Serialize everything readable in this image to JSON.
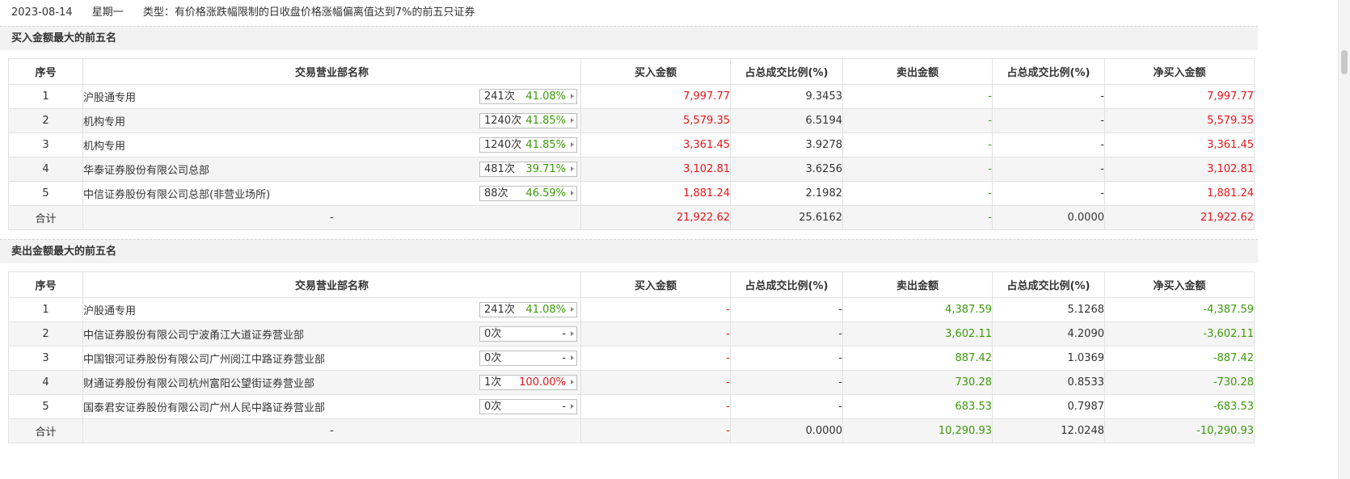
{
  "info": {
    "date": "2023-08-14",
    "weekday": "星期一",
    "type_text": "类型：有价格涨跌幅限制的日收盘价格涨幅偏离值达到7%的前五只证券"
  },
  "columns": [
    "序号",
    "交易营业部名称",
    "买入金额",
    "占总成交比例(%)",
    "卖出金额",
    "占总成交比例(%)",
    "净买入金额"
  ],
  "buy_section": {
    "title": "买入金额最大的前五名",
    "rows": [
      {
        "idx": "1",
        "name": "沪股通专用",
        "count": "241次",
        "pct": "41.08%",
        "pct_color": "green",
        "buy": "7,997.77",
        "buy_ratio": "9.3453",
        "sell": "-",
        "sell_ratio": "-",
        "net": "7,997.77"
      },
      {
        "idx": "2",
        "name": "机构专用",
        "count": "1240次",
        "pct": "41.85%",
        "pct_color": "green",
        "buy": "5,579.35",
        "buy_ratio": "6.5194",
        "sell": "-",
        "sell_ratio": "-",
        "net": "5,579.35"
      },
      {
        "idx": "3",
        "name": "机构专用",
        "count": "1240次",
        "pct": "41.85%",
        "pct_color": "green",
        "buy": "3,361.45",
        "buy_ratio": "3.9278",
        "sell": "-",
        "sell_ratio": "-",
        "net": "3,361.45"
      },
      {
        "idx": "4",
        "name": "华泰证券股份有限公司总部",
        "count": "481次",
        "pct": "39.71%",
        "pct_color": "green",
        "buy": "3,102.81",
        "buy_ratio": "3.6256",
        "sell": "-",
        "sell_ratio": "-",
        "net": "3,102.81"
      },
      {
        "idx": "5",
        "name": "中信证券股份有限公司总部(非营业场所)",
        "count": "88次",
        "pct": "46.59%",
        "pct_color": "green",
        "buy": "1,881.24",
        "buy_ratio": "2.1982",
        "sell": "-",
        "sell_ratio": "-",
        "net": "1,881.24"
      }
    ],
    "total": {
      "label": "合计",
      "name": "-",
      "buy": "21,922.62",
      "buy_ratio": "25.6162",
      "sell": "-",
      "sell_ratio": "0.0000",
      "net": "21,922.62"
    }
  },
  "sell_section": {
    "title": "卖出金额最大的前五名",
    "rows": [
      {
        "idx": "1",
        "name": "沪股通专用",
        "count": "241次",
        "pct": "41.08%",
        "pct_color": "green",
        "buy": "-",
        "buy_ratio": "-",
        "sell": "4,387.59",
        "sell_ratio": "5.1268",
        "net": "-4,387.59"
      },
      {
        "idx": "2",
        "name": "中信证券股份有限公司宁波甬江大道证券营业部",
        "count": "0次",
        "pct": "-",
        "pct_color": "plain",
        "buy": "-",
        "buy_ratio": "-",
        "sell": "3,602.11",
        "sell_ratio": "4.2090",
        "net": "-3,602.11"
      },
      {
        "idx": "3",
        "name": "中国银河证券股份有限公司广州阅江中路证券营业部",
        "count": "0次",
        "pct": "-",
        "pct_color": "plain",
        "buy": "-",
        "buy_ratio": "-",
        "sell": "887.42",
        "sell_ratio": "1.0369",
        "net": "-887.42"
      },
      {
        "idx": "4",
        "name": "财通证券股份有限公司杭州富阳公望街证券营业部",
        "count": "1次",
        "pct": "100.00%",
        "pct_color": "red",
        "buy": "-",
        "buy_ratio": "-",
        "sell": "730.28",
        "sell_ratio": "0.8533",
        "net": "-730.28"
      },
      {
        "idx": "5",
        "name": "国泰君安证券股份有限公司广州人民中路证券营业部",
        "count": "0次",
        "pct": "-",
        "pct_color": "plain",
        "buy": "-",
        "buy_ratio": "-",
        "sell": "683.53",
        "sell_ratio": "0.7987",
        "net": "-683.53"
      }
    ],
    "total": {
      "label": "合计",
      "name": "-",
      "buy": "-",
      "buy_ratio": "0.0000",
      "sell": "10,290.93",
      "sell_ratio": "12.0248",
      "net": "-10,290.93"
    }
  },
  "colors": {
    "up": "#e4161a",
    "down": "#3c9a0a",
    "header_bg": "#f2f2f2",
    "row_alt_bg": "#f5f5f5"
  }
}
